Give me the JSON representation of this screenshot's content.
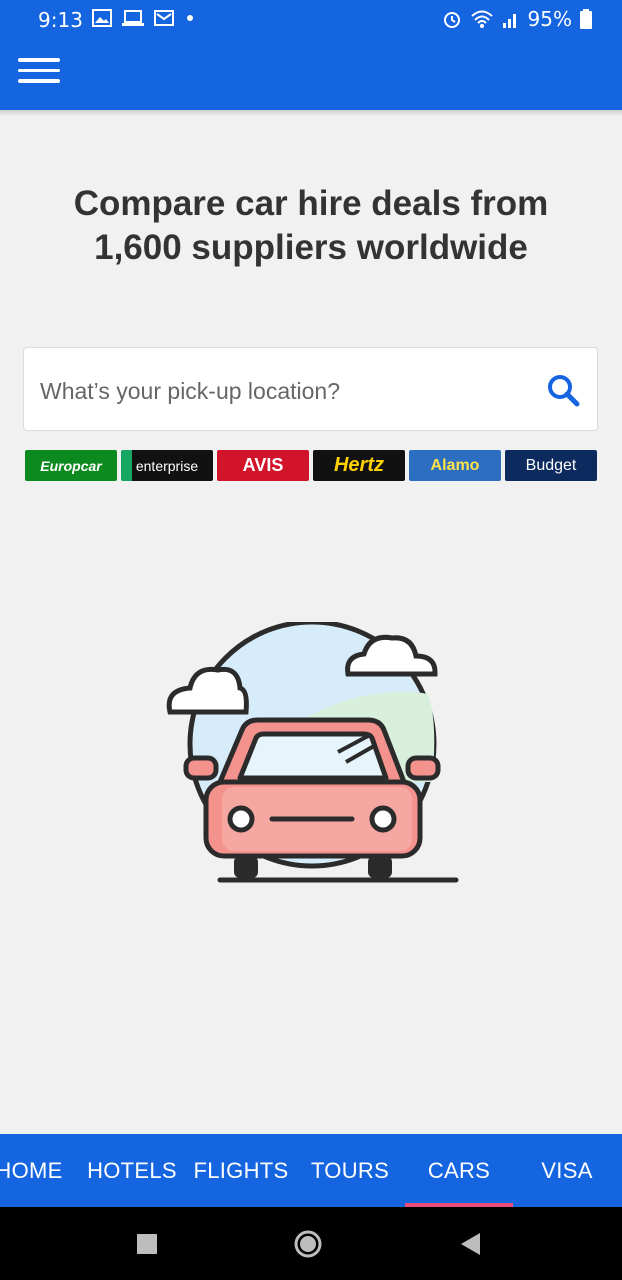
{
  "status_bar": {
    "time": "9:13",
    "battery": "95%",
    "icons": [
      "image-icon",
      "laptop-icon",
      "mail-icon",
      "dot-icon",
      "alarm-icon",
      "wifi-icon",
      "signal-icon",
      "battery-icon"
    ]
  },
  "app_bar": {
    "menu_icon": "hamburger-menu-icon"
  },
  "hero": {
    "headline_line1": "Compare car hire deals from",
    "headline_line2": "1,600 suppliers worldwide"
  },
  "search": {
    "placeholder": "What’s your pick-up location?",
    "value": "",
    "icon": "search-icon"
  },
  "suppliers": [
    {
      "label": "Europcar"
    },
    {
      "label": "enterprise"
    },
    {
      "label": "AVIS"
    },
    {
      "label": "Hertz"
    },
    {
      "label": "Alamo"
    },
    {
      "label": "Budget"
    }
  ],
  "tabs": [
    {
      "label": "HOME"
    },
    {
      "label": "HOTELS"
    },
    {
      "label": "FLIGHTS"
    },
    {
      "label": "TOURS"
    },
    {
      "label": "CARS",
      "active": true
    },
    {
      "label": "VISA"
    }
  ],
  "system_nav": [
    "recents-square-icon",
    "home-circle-icon",
    "back-triangle-icon"
  ],
  "colors": {
    "primary": "#1565e0",
    "active_tab_indicator": "#e84a7a",
    "car": "#f4938e"
  }
}
